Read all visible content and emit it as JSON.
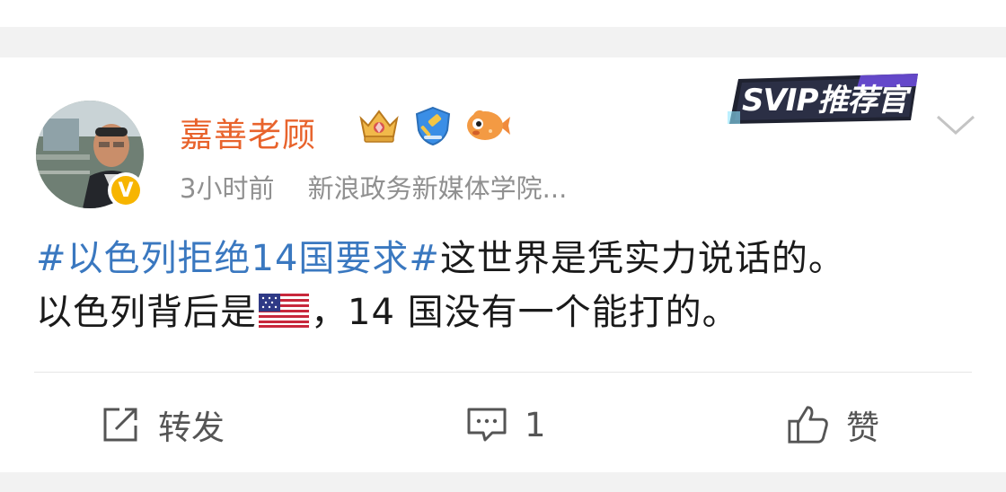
{
  "post": {
    "author": "嘉善老顾",
    "time": "3小时前",
    "source": "新浪政务新媒体学院...",
    "topic": "#以色列拒绝14国要求#",
    "text_line1": "这世界是凭实力说话的。",
    "text_line2_a": "以色列背后是",
    "flag_icon": "us-flag-icon",
    "text_line2_b": "，14 国没有一个能打的。"
  },
  "badges": [
    "crown-badge-icon",
    "gavel-shield-badge-icon",
    "fish-badge-icon"
  ],
  "promo": {
    "label": "SVIP推荐官"
  },
  "actions": {
    "repost_label": "转发",
    "comment_count": "1",
    "like_label": "赞"
  },
  "colors": {
    "author": "#e8632c",
    "topic": "#3a78c0",
    "meta": "#909090",
    "verified": "#f7b500"
  }
}
